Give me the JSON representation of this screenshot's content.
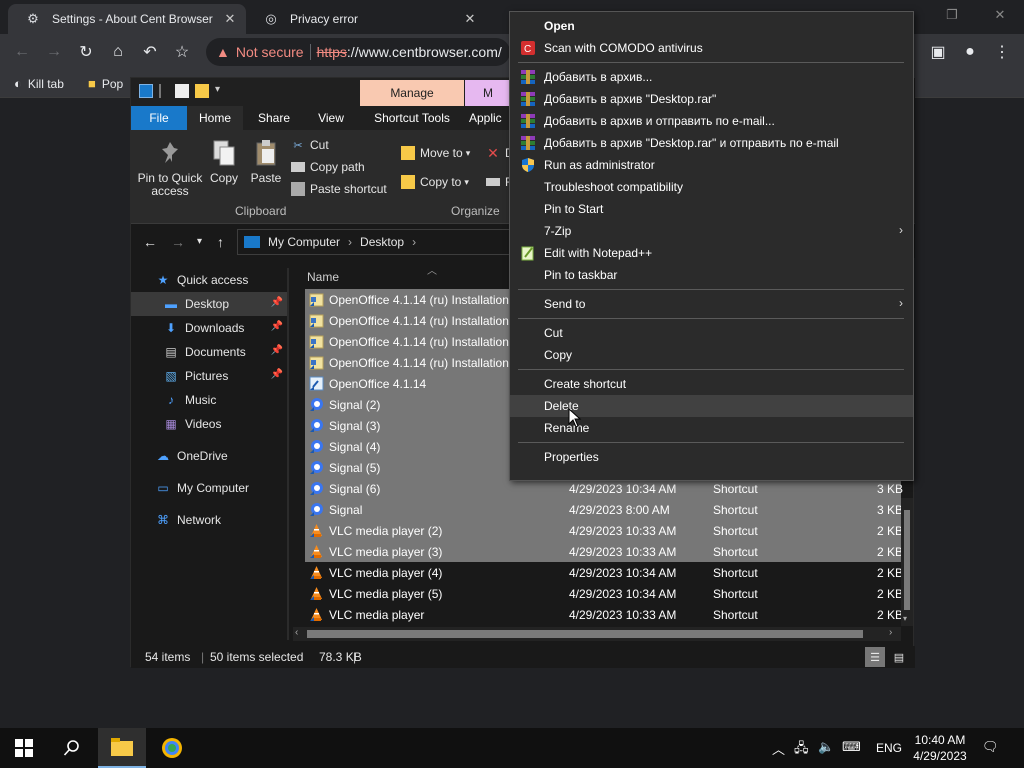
{
  "browser": {
    "tabs": [
      {
        "label": "Settings - About Cent Browser",
        "active": true
      },
      {
        "label": "Privacy error",
        "active": false
      }
    ],
    "omnibox": {
      "warning_text": "Not secure",
      "scheme": "https",
      "host": "://www.centbrowser.com/"
    },
    "bookmarks": [
      {
        "label": "Kill tab",
        "icon": "kill-tab-icon"
      },
      {
        "label": "Pop",
        "icon": "folder-icon"
      }
    ]
  },
  "explorer": {
    "context_tab_header": "Manage",
    "context_tab_header_2": "M",
    "ribbon_tabs": [
      "File",
      "Home",
      "Share",
      "View",
      "Shortcut Tools",
      "Applic"
    ],
    "clipboard": {
      "pin_label_1": "Pin to Quick",
      "pin_label_2": "access",
      "copy": "Copy",
      "paste": "Paste",
      "cut": "Cut",
      "copy_path": "Copy path",
      "paste_shortcut": "Paste shortcut",
      "group_label": "Clipboard"
    },
    "organize": {
      "move_to": "Move to",
      "copy_to": "Copy to",
      "d_partial": "D",
      "r_partial": "R",
      "group_label": "Organize"
    },
    "address": {
      "segments": [
        "My Computer",
        "Desktop"
      ]
    },
    "nav_pane": [
      {
        "label": "Quick access",
        "icon": "star-icon",
        "selected": false,
        "pinned": false,
        "indent": 1
      },
      {
        "label": "Desktop",
        "icon": "desktop-icon",
        "selected": true,
        "pinned": true,
        "indent": 2
      },
      {
        "label": "Downloads",
        "icon": "download-icon",
        "selected": false,
        "pinned": true,
        "indent": 2
      },
      {
        "label": "Documents",
        "icon": "documents-icon",
        "selected": false,
        "pinned": true,
        "indent": 2
      },
      {
        "label": "Pictures",
        "icon": "pictures-icon",
        "selected": false,
        "pinned": true,
        "indent": 2
      },
      {
        "label": "Music",
        "icon": "music-icon",
        "selected": false,
        "pinned": false,
        "indent": 2
      },
      {
        "label": "Videos",
        "icon": "videos-icon",
        "selected": false,
        "pinned": false,
        "indent": 2
      },
      {
        "label": "OneDrive",
        "icon": "cloud-icon",
        "selected": false,
        "pinned": false,
        "indent": 1
      },
      {
        "label": "My Computer",
        "icon": "computer-icon",
        "selected": false,
        "pinned": false,
        "indent": 1
      },
      {
        "label": "Network",
        "icon": "network-icon",
        "selected": false,
        "pinned": false,
        "indent": 1
      }
    ],
    "column_header_name": "Name",
    "files": [
      {
        "name": "OpenOffice 4.1.14 (ru) Installation",
        "date": "",
        "type": "",
        "size": "",
        "selected": true,
        "icon": "installer"
      },
      {
        "name": "OpenOffice 4.1.14 (ru) Installation",
        "date": "",
        "type": "",
        "size": "",
        "selected": true,
        "icon": "installer"
      },
      {
        "name": "OpenOffice 4.1.14 (ru) Installation",
        "date": "",
        "type": "",
        "size": "",
        "selected": true,
        "icon": "installer"
      },
      {
        "name": "OpenOffice 4.1.14 (ru) Installation",
        "date": "",
        "type": "",
        "size": "",
        "selected": true,
        "icon": "installer"
      },
      {
        "name": "OpenOffice 4.1.14",
        "date": "",
        "type": "",
        "size": "",
        "selected": true,
        "icon": "shortcut"
      },
      {
        "name": "Signal (2)",
        "date": "",
        "type": "",
        "size": "",
        "selected": true,
        "icon": "signal"
      },
      {
        "name": "Signal (3)",
        "date": "",
        "type": "",
        "size": "",
        "selected": true,
        "icon": "signal"
      },
      {
        "name": "Signal (4)",
        "date": "",
        "type": "",
        "size": "",
        "selected": true,
        "icon": "signal"
      },
      {
        "name": "Signal (5)",
        "date": "",
        "type": "",
        "size": "",
        "selected": true,
        "icon": "signal"
      },
      {
        "name": "Signal (6)",
        "date": "4/29/2023 10:34 AM",
        "type": "Shortcut",
        "size": "3 KB",
        "selected": true,
        "icon": "signal"
      },
      {
        "name": "Signal",
        "date": "4/29/2023 8:00 AM",
        "type": "Shortcut",
        "size": "3 KB",
        "selected": true,
        "icon": "signal"
      },
      {
        "name": "VLC media player (2)",
        "date": "4/29/2023 10:33 AM",
        "type": "Shortcut",
        "size": "2 KB",
        "selected": true,
        "icon": "vlc"
      },
      {
        "name": "VLC media player (3)",
        "date": "4/29/2023 10:33 AM",
        "type": "Shortcut",
        "size": "2 KB",
        "selected": true,
        "icon": "vlc"
      },
      {
        "name": "VLC media player (4)",
        "date": "4/29/2023 10:34 AM",
        "type": "Shortcut",
        "size": "2 KB",
        "selected": false,
        "icon": "vlc"
      },
      {
        "name": "VLC media player (5)",
        "date": "4/29/2023 10:34 AM",
        "type": "Shortcut",
        "size": "2 KB",
        "selected": false,
        "icon": "vlc"
      },
      {
        "name": "VLC media player",
        "date": "4/29/2023 10:33 AM",
        "type": "Shortcut",
        "size": "2 KB",
        "selected": false,
        "icon": "vlc"
      }
    ],
    "status": {
      "items": "54 items",
      "selected": "50 items selected",
      "size": "78.3 KB"
    }
  },
  "context_menu": [
    {
      "type": "item",
      "label": "Open",
      "bold": true,
      "icon": "",
      "submenu": false
    },
    {
      "type": "item",
      "label": "Scan with COMODO antivirus",
      "icon": "comodo-icon",
      "submenu": false
    },
    {
      "type": "sep"
    },
    {
      "type": "item",
      "label": "Добавить в архив...",
      "icon": "winrar-icon",
      "submenu": false
    },
    {
      "type": "item",
      "label": "Добавить в архив \"Desktop.rar\"",
      "icon": "winrar-icon",
      "submenu": false
    },
    {
      "type": "item",
      "label": "Добавить в архив и отправить по e-mail...",
      "icon": "winrar-icon",
      "submenu": false
    },
    {
      "type": "item",
      "label": "Добавить в архив \"Desktop.rar\" и отправить по e-mail",
      "icon": "winrar-icon",
      "submenu": false
    },
    {
      "type": "item",
      "label": "Run as administrator",
      "icon": "uac-shield-icon",
      "submenu": false
    },
    {
      "type": "item",
      "label": "Troubleshoot compatibility",
      "icon": "",
      "submenu": false
    },
    {
      "type": "item",
      "label": "Pin to Start",
      "icon": "",
      "submenu": false
    },
    {
      "type": "item",
      "label": "7-Zip",
      "icon": "",
      "submenu": true
    },
    {
      "type": "item",
      "label": "Edit with Notepad++",
      "icon": "notepadpp-icon",
      "submenu": false
    },
    {
      "type": "item",
      "label": "Pin to taskbar",
      "icon": "",
      "submenu": false
    },
    {
      "type": "sep"
    },
    {
      "type": "item",
      "label": "Send to",
      "icon": "",
      "submenu": true
    },
    {
      "type": "sep"
    },
    {
      "type": "item",
      "label": "Cut",
      "icon": "",
      "submenu": false
    },
    {
      "type": "item",
      "label": "Copy",
      "icon": "",
      "submenu": false
    },
    {
      "type": "sep"
    },
    {
      "type": "item",
      "label": "Create shortcut",
      "icon": "",
      "submenu": false
    },
    {
      "type": "item",
      "label": "Delete",
      "icon": "",
      "submenu": false,
      "hover": true
    },
    {
      "type": "item",
      "label": "Rename",
      "icon": "",
      "submenu": false
    },
    {
      "type": "sep"
    },
    {
      "type": "item",
      "label": "Properties",
      "icon": "",
      "submenu": false
    }
  ],
  "taskbar": {
    "language": "ENG",
    "time": "10:40 AM",
    "date": "4/29/2023"
  },
  "colors": {
    "selection": "#777777",
    "file_tab": "#1979ca",
    "manage_tab": "#f9c9b1",
    "m_tab": "#e6b8f0",
    "insecure": "#f28b82"
  }
}
